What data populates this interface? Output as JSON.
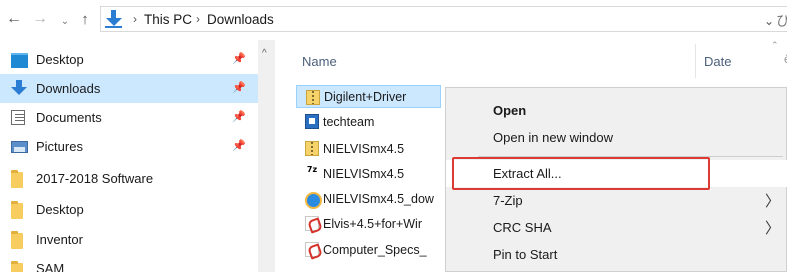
{
  "address_bar": {
    "back_glyph": "←",
    "forward_glyph": "→",
    "recent_glyph": "⌄",
    "up_glyph": "↑",
    "path_separator_glyph": "›",
    "breadcrumbs": [
      "This PC",
      "Downloads"
    ],
    "dropdown_glyph": "⌄",
    "refresh_glyph": "ひ"
  },
  "nav_pane": {
    "pin_glyph": "📌",
    "scroll_up_glyph": "^",
    "items": [
      {
        "label": "Desktop",
        "icon": "desktop-icon",
        "pinned": true
      },
      {
        "label": "Downloads",
        "icon": "download-icon",
        "pinned": true,
        "selected": true
      },
      {
        "label": "Documents",
        "icon": "documents-icon",
        "pinned": true
      },
      {
        "label": "Pictures",
        "icon": "pictures-icon",
        "pinned": true
      },
      {
        "label": "2017-2018 Software",
        "icon": "folder-icon",
        "pinned": false
      },
      {
        "label": "Desktop",
        "icon": "folder-icon",
        "pinned": false
      },
      {
        "label": "Inventor",
        "icon": "folder-icon",
        "pinned": false
      },
      {
        "label": "SAM",
        "icon": "folder-icon",
        "pinned": false
      }
    ]
  },
  "file_list": {
    "columns": {
      "name": "Name",
      "date": "Date"
    },
    "sort_glyph": "⌃",
    "extra_glyph": "ě",
    "files": [
      {
        "name": "Digilent+Driver",
        "icon": "zip-folder-icon",
        "selected": true
      },
      {
        "name": "techteam",
        "icon": "team-file-icon"
      },
      {
        "name": "NIELVISmx4.5",
        "icon": "zip-folder-icon"
      },
      {
        "name": "NIELVISmx4.5",
        "icon": "7z-archive-icon"
      },
      {
        "name": "NIELVISmx4.5_dow",
        "icon": "internet-shortcut-icon"
      },
      {
        "name": "Elvis+4.5+for+Wir",
        "icon": "pdf-icon"
      },
      {
        "name": "Computer_Specs_",
        "icon": "pdf-icon"
      }
    ]
  },
  "context_menu": {
    "submenu_glyph": "〉",
    "items": [
      {
        "label": "Open",
        "bold": true
      },
      {
        "label": "Open in new window"
      },
      {
        "label": "Extract All...",
        "highlighted": true
      },
      {
        "label": "7-Zip",
        "submenu": true
      },
      {
        "label": "CRC SHA",
        "submenu": true
      },
      {
        "label": "Pin to Start"
      }
    ],
    "highlight_color": "#dc3b34"
  },
  "seven_zip_icon_text": "7z"
}
